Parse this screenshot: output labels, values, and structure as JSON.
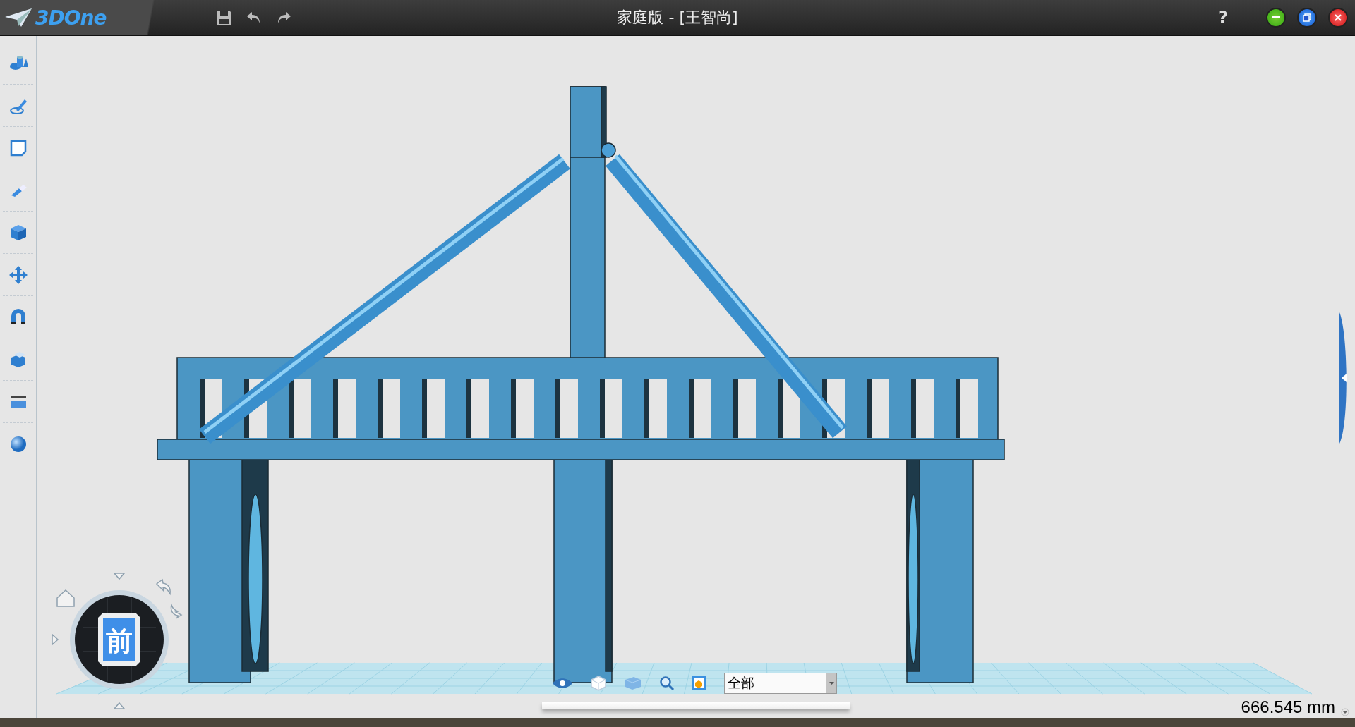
{
  "app": {
    "logo": "3DOne"
  },
  "window": {
    "title": "家庭版 - [王智尚]",
    "help": "?"
  },
  "view_cube": {
    "face": "前"
  },
  "view_bar": {
    "filter": "全部"
  },
  "measurement": "666.545 mm"
}
